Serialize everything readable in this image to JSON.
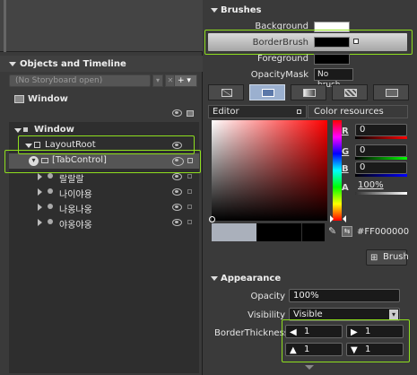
{
  "objects_timeline": {
    "title": "Objects and Timeline",
    "storyboard_placeholder": "(No Storyboard open)",
    "add_label": "+",
    "window_label": "Window",
    "tree": [
      {
        "label": "Window",
        "level": 0
      },
      {
        "label": "LayoutRoot",
        "level": 1
      },
      {
        "label": "[TabControl]",
        "level": 2
      },
      {
        "label": "랄랄랄",
        "level": 3
      },
      {
        "label": "나이야용",
        "level": 3
      },
      {
        "label": "나옹나옹",
        "level": 3
      },
      {
        "label": "야옹야옹",
        "level": 3
      }
    ]
  },
  "brushes": {
    "title": "Brushes",
    "items": [
      {
        "label": "Background",
        "value": ""
      },
      {
        "label": "BorderBrush",
        "value": ""
      },
      {
        "label": "Foreground",
        "value": ""
      },
      {
        "label": "OpacityMask",
        "value": "No brush"
      }
    ],
    "colors": {
      "background": "#ffffff",
      "borderbrush": "#000000",
      "foreground": "#000000"
    }
  },
  "editor": {
    "tab_editor": "Editor",
    "tab_resources": "Color resources",
    "r_label": "R",
    "g_label": "G",
    "b_label": "B",
    "a_label": "A",
    "r_value": "0",
    "g_value": "0",
    "b_value": "0",
    "a_value": "100%",
    "hex": "#FF000000",
    "brush_button": "Brush"
  },
  "appearance": {
    "title": "Appearance",
    "opacity_label": "Opacity",
    "opacity_value": "100%",
    "visibility_label": "Visibility",
    "visibility_value": "Visible",
    "thickness_label": "BorderThickness",
    "thickness": {
      "left": "1",
      "right": "1",
      "top": "1",
      "bottom": "1"
    }
  }
}
